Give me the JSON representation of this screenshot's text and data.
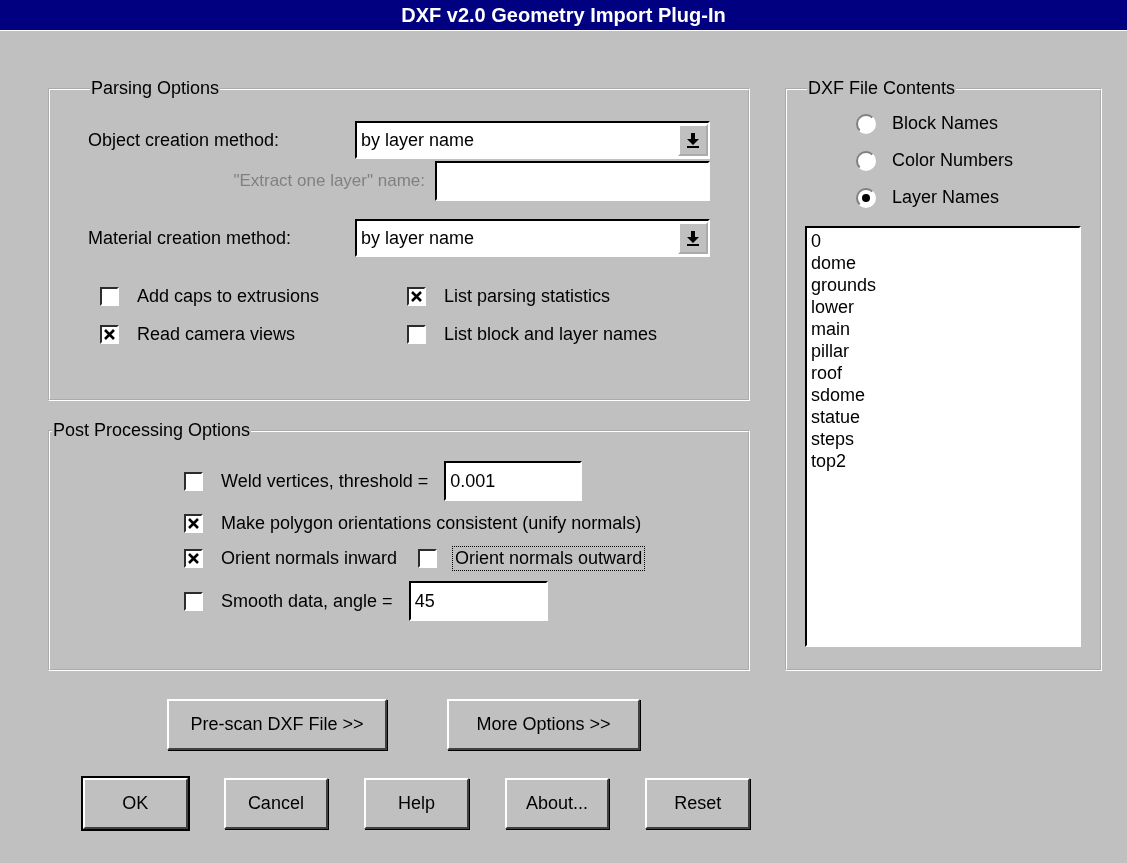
{
  "window": {
    "title": "DXF v2.0 Geometry Import Plug-In"
  },
  "parsing_options": {
    "title": "Parsing Options",
    "object_method": {
      "label": "Object creation method:",
      "value": "by layer name"
    },
    "extract_layer": {
      "label": "\"Extract one layer\" name:",
      "disabled": true
    },
    "material_method": {
      "label": "Material creation method:",
      "value": "by layer name"
    },
    "checkboxes": [
      {
        "label": "Add caps to extrusions",
        "checked": false
      },
      {
        "label": "List parsing statistics",
        "checked": true
      },
      {
        "label": "Read camera views",
        "checked": true
      },
      {
        "label": "List block and layer names",
        "checked": false
      }
    ]
  },
  "post_processing": {
    "title": "Post Processing Options",
    "rows": [
      [
        {
          "label": "Weld vertices, threshold =",
          "checked": false,
          "focused": false,
          "value": "0.001"
        }
      ],
      [
        {
          "label": "Make polygon orientations consistent (unify normals)",
          "checked": true,
          "focused": false
        }
      ],
      [
        {
          "label": "Orient normals inward",
          "checked": true,
          "focused": false
        },
        {
          "label": "Orient normals outward",
          "checked": false,
          "focused": true
        }
      ],
      [
        {
          "label": "Smooth data, angle =",
          "checked": false,
          "focused": false,
          "value": "45"
        }
      ]
    ]
  },
  "file_contents": {
    "title": "DXF File Contents",
    "radios": [
      {
        "label": "Block Names",
        "selected": false
      },
      {
        "label": "Color Numbers",
        "selected": false
      },
      {
        "label": "Layer Names",
        "selected": true
      }
    ],
    "list_items": [
      "0",
      "dome",
      "grounds",
      "lower",
      "main",
      "pillar",
      "roof",
      "sdome",
      "statue",
      "steps",
      "top2"
    ]
  },
  "action_buttons": [
    "Pre-scan DXF File >>",
    "More Options >>"
  ],
  "dialog_buttons": [
    {
      "label": "OK",
      "default": true
    },
    {
      "label": "Cancel",
      "default": false
    },
    {
      "label": "Help",
      "default": false
    },
    {
      "label": "About...",
      "default": false
    },
    {
      "label": "Reset",
      "default": false
    }
  ]
}
